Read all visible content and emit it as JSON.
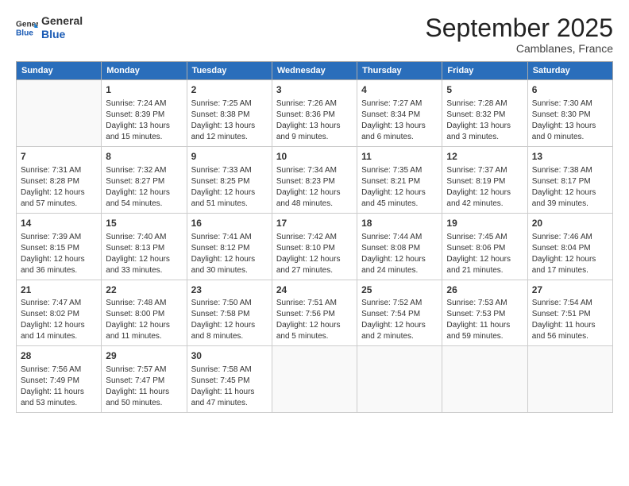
{
  "logo": {
    "general": "General",
    "blue": "Blue"
  },
  "title": "September 2025",
  "location": "Camblanes, France",
  "days_header": [
    "Sunday",
    "Monday",
    "Tuesday",
    "Wednesday",
    "Thursday",
    "Friday",
    "Saturday"
  ],
  "weeks": [
    [
      {
        "day": "",
        "content": ""
      },
      {
        "day": "1",
        "content": "Sunrise: 7:24 AM\nSunset: 8:39 PM\nDaylight: 13 hours\nand 15 minutes."
      },
      {
        "day": "2",
        "content": "Sunrise: 7:25 AM\nSunset: 8:38 PM\nDaylight: 13 hours\nand 12 minutes."
      },
      {
        "day": "3",
        "content": "Sunrise: 7:26 AM\nSunset: 8:36 PM\nDaylight: 13 hours\nand 9 minutes."
      },
      {
        "day": "4",
        "content": "Sunrise: 7:27 AM\nSunset: 8:34 PM\nDaylight: 13 hours\nand 6 minutes."
      },
      {
        "day": "5",
        "content": "Sunrise: 7:28 AM\nSunset: 8:32 PM\nDaylight: 13 hours\nand 3 minutes."
      },
      {
        "day": "6",
        "content": "Sunrise: 7:30 AM\nSunset: 8:30 PM\nDaylight: 13 hours\nand 0 minutes."
      }
    ],
    [
      {
        "day": "7",
        "content": "Sunrise: 7:31 AM\nSunset: 8:28 PM\nDaylight: 12 hours\nand 57 minutes."
      },
      {
        "day": "8",
        "content": "Sunrise: 7:32 AM\nSunset: 8:27 PM\nDaylight: 12 hours\nand 54 minutes."
      },
      {
        "day": "9",
        "content": "Sunrise: 7:33 AM\nSunset: 8:25 PM\nDaylight: 12 hours\nand 51 minutes."
      },
      {
        "day": "10",
        "content": "Sunrise: 7:34 AM\nSunset: 8:23 PM\nDaylight: 12 hours\nand 48 minutes."
      },
      {
        "day": "11",
        "content": "Sunrise: 7:35 AM\nSunset: 8:21 PM\nDaylight: 12 hours\nand 45 minutes."
      },
      {
        "day": "12",
        "content": "Sunrise: 7:37 AM\nSunset: 8:19 PM\nDaylight: 12 hours\nand 42 minutes."
      },
      {
        "day": "13",
        "content": "Sunrise: 7:38 AM\nSunset: 8:17 PM\nDaylight: 12 hours\nand 39 minutes."
      }
    ],
    [
      {
        "day": "14",
        "content": "Sunrise: 7:39 AM\nSunset: 8:15 PM\nDaylight: 12 hours\nand 36 minutes."
      },
      {
        "day": "15",
        "content": "Sunrise: 7:40 AM\nSunset: 8:13 PM\nDaylight: 12 hours\nand 33 minutes."
      },
      {
        "day": "16",
        "content": "Sunrise: 7:41 AM\nSunset: 8:12 PM\nDaylight: 12 hours\nand 30 minutes."
      },
      {
        "day": "17",
        "content": "Sunrise: 7:42 AM\nSunset: 8:10 PM\nDaylight: 12 hours\nand 27 minutes."
      },
      {
        "day": "18",
        "content": "Sunrise: 7:44 AM\nSunset: 8:08 PM\nDaylight: 12 hours\nand 24 minutes."
      },
      {
        "day": "19",
        "content": "Sunrise: 7:45 AM\nSunset: 8:06 PM\nDaylight: 12 hours\nand 21 minutes."
      },
      {
        "day": "20",
        "content": "Sunrise: 7:46 AM\nSunset: 8:04 PM\nDaylight: 12 hours\nand 17 minutes."
      }
    ],
    [
      {
        "day": "21",
        "content": "Sunrise: 7:47 AM\nSunset: 8:02 PM\nDaylight: 12 hours\nand 14 minutes."
      },
      {
        "day": "22",
        "content": "Sunrise: 7:48 AM\nSunset: 8:00 PM\nDaylight: 12 hours\nand 11 minutes."
      },
      {
        "day": "23",
        "content": "Sunrise: 7:50 AM\nSunset: 7:58 PM\nDaylight: 12 hours\nand 8 minutes."
      },
      {
        "day": "24",
        "content": "Sunrise: 7:51 AM\nSunset: 7:56 PM\nDaylight: 12 hours\nand 5 minutes."
      },
      {
        "day": "25",
        "content": "Sunrise: 7:52 AM\nSunset: 7:54 PM\nDaylight: 12 hours\nand 2 minutes."
      },
      {
        "day": "26",
        "content": "Sunrise: 7:53 AM\nSunset: 7:53 PM\nDaylight: 11 hours\nand 59 minutes."
      },
      {
        "day": "27",
        "content": "Sunrise: 7:54 AM\nSunset: 7:51 PM\nDaylight: 11 hours\nand 56 minutes."
      }
    ],
    [
      {
        "day": "28",
        "content": "Sunrise: 7:56 AM\nSunset: 7:49 PM\nDaylight: 11 hours\nand 53 minutes."
      },
      {
        "day": "29",
        "content": "Sunrise: 7:57 AM\nSunset: 7:47 PM\nDaylight: 11 hours\nand 50 minutes."
      },
      {
        "day": "30",
        "content": "Sunrise: 7:58 AM\nSunset: 7:45 PM\nDaylight: 11 hours\nand 47 minutes."
      },
      {
        "day": "",
        "content": ""
      },
      {
        "day": "",
        "content": ""
      },
      {
        "day": "",
        "content": ""
      },
      {
        "day": "",
        "content": ""
      }
    ]
  ]
}
